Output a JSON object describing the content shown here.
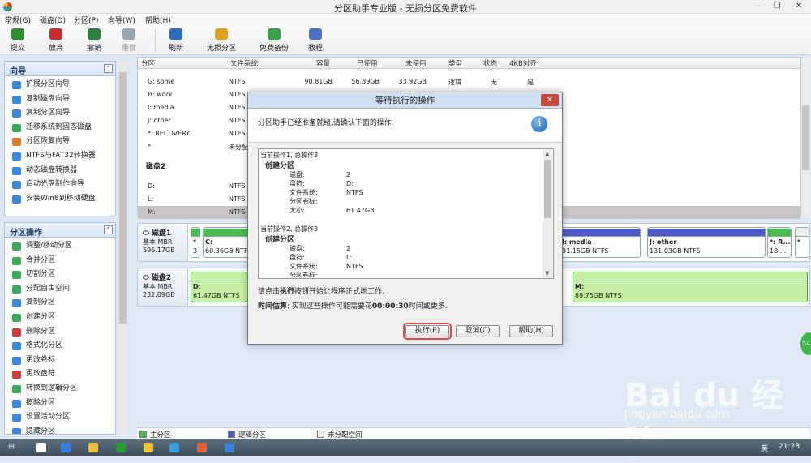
{
  "window": {
    "title": "分区助手专业版 - 无损分区免费软件",
    "min_label": "—",
    "max_label": "❐",
    "close_label": "✕"
  },
  "menu": [
    "常规(G)",
    "磁盘(D)",
    "分区(P)",
    "向导(W)",
    "帮助(H)"
  ],
  "toolbar": [
    {
      "label": "提交",
      "color": "#2f8f2f",
      "disabled": false
    },
    {
      "label": "放弃",
      "color": "#cc2b2b",
      "disabled": false
    },
    {
      "label": "撤销",
      "color": "#2f7f3f",
      "disabled": false
    },
    {
      "label": "重做",
      "color": "#9aa6b0",
      "disabled": true
    },
    {
      "label": "刷新",
      "color": "#2a6cc2",
      "disabled": false
    },
    {
      "label": "无损分区",
      "color": "#e0a020",
      "disabled": false
    },
    {
      "label": "免费备份",
      "color": "#3aa04a",
      "disabled": false
    },
    {
      "label": "教程",
      "color": "#4a72c4",
      "disabled": false
    }
  ],
  "wizard_panel": {
    "title": "向导",
    "collapse": "⌃",
    "items": [
      {
        "label": "扩展分区向导",
        "color": "#3d88d9"
      },
      {
        "label": "复制磁盘向导",
        "color": "#3d88d9"
      },
      {
        "label": "复制分区向导",
        "color": "#3d88d9"
      },
      {
        "label": "迁移系统到固态磁盘",
        "color": "#3da95a"
      },
      {
        "label": "分区恢复向导",
        "color": "#e07b28"
      },
      {
        "label": "NTFS与FAT32转换器",
        "color": "#3d88d9"
      },
      {
        "label": "动态磁盘转换器",
        "color": "#3d88d9"
      },
      {
        "label": "启动光盘制作向导",
        "color": "#3d88d9"
      },
      {
        "label": "安装Win8到移动硬盘",
        "color": "#3d88d9"
      }
    ]
  },
  "ops_panel": {
    "title": "分区操作",
    "collapse": "⌃",
    "items": [
      {
        "label": "调整/移动分区",
        "color": "#3da95a"
      },
      {
        "label": "合并分区",
        "color": "#3da95a"
      },
      {
        "label": "切割分区",
        "color": "#3da95a"
      },
      {
        "label": "分配自由空间",
        "color": "#3da95a"
      },
      {
        "label": "复制分区",
        "color": "#3d88d9"
      },
      {
        "label": "创建分区",
        "color": "#3da95a"
      },
      {
        "label": "删除分区",
        "color": "#d33b3b"
      },
      {
        "label": "格式化分区",
        "color": "#3d88d9"
      },
      {
        "label": "更改卷标",
        "color": "#3d88d9"
      },
      {
        "label": "更改盘符",
        "color": "#d33b3b"
      },
      {
        "label": "转换到逻辑分区",
        "color": "#3da95a"
      },
      {
        "label": "擦除分区",
        "color": "#3d88d9"
      },
      {
        "label": "设置活动分区",
        "color": "#3d88d9"
      },
      {
        "label": "隐藏分区",
        "color": "#3d88d9"
      }
    ]
  },
  "table": {
    "headers": [
      "分区",
      "文件系统",
      "容量",
      "已使用",
      "未使用",
      "类型",
      "状态",
      "4KB对齐"
    ],
    "rows": [
      {
        "name": "G: some",
        "fs": "NTFS",
        "cap": "90.81GB",
        "used": "56.89GB",
        "free": "33.92GB",
        "type": "逻辑",
        "status": "无",
        "align": "是"
      },
      {
        "name": "H: work",
        "fs": "NTFS",
        "cap": "",
        "used": "",
        "free": "",
        "type": "",
        "status": "",
        "align": ""
      },
      {
        "name": "I: media",
        "fs": "NTFS",
        "cap": "",
        "used": "",
        "free": "",
        "type": "",
        "status": "",
        "align": ""
      },
      {
        "name": "J: other",
        "fs": "NTFS",
        "cap": "",
        "used": "",
        "free": "",
        "type": "",
        "status": "",
        "align": ""
      },
      {
        "name": "*: RECOVERY",
        "fs": "NTFS",
        "cap": "",
        "used": "",
        "free": "",
        "type": "",
        "status": "",
        "align": ""
      },
      {
        "name": "*",
        "fs": "未分配",
        "cap": "",
        "used": "",
        "free": "",
        "type": "",
        "status": "",
        "align": ""
      }
    ],
    "disk2_label": "磁盘2",
    "disk2_rows": [
      {
        "name": "D:",
        "fs": "NTFS"
      },
      {
        "name": "L:",
        "fs": "NTFS"
      },
      {
        "name": "M:",
        "fs": "NTFS"
      }
    ]
  },
  "disk1": {
    "name": "磁盘1",
    "kind": "基本 MBR",
    "size": "596.17GB",
    "parts": [
      {
        "name": "*",
        "size": "3",
        "bar": "#4dbb4d"
      },
      {
        "name": "C:",
        "size": "60.36GB NTFS",
        "bar": "#4dbb4d"
      },
      {
        "name": "I: media",
        "size": "91.15GB NTFS",
        "bar": "#5058c8"
      },
      {
        "name": "J: other",
        "size": "131.03GB NTFS",
        "bar": "#5058c8"
      },
      {
        "name": "*: R...",
        "size": "18....",
        "bar": "#4dbb4d"
      },
      {
        "name": "*",
        "size": "",
        "bar": "#eeeeee"
      }
    ]
  },
  "disk2": {
    "name": "磁盘2",
    "kind": "基本 MBR",
    "size": "232.89GB",
    "parts": [
      {
        "name": "D:",
        "size": "61.47GB NTFS",
        "bar": "#c8f0a4"
      },
      {
        "name": "M:",
        "size": "89.75GB NTFS",
        "bar": "#c8f0a4"
      }
    ]
  },
  "legend": [
    {
      "label": "主分区",
      "color": "#4dbb4d"
    },
    {
      "label": "逻辑分区",
      "color": "#5058c8"
    },
    {
      "label": "未分配空间",
      "color": "#f4efe6"
    }
  ],
  "dialog": {
    "title": "等待执行的操作",
    "close": "✕",
    "banner": "分区助手已经准备就绪,请确认下面的操作.",
    "info_icon": "i",
    "ops": [
      {
        "head": "当前操作1, 总操作3",
        "sub": "创建分区",
        "rows": [
          [
            "磁盘:",
            "2"
          ],
          [
            "盘符:",
            "D:"
          ],
          [
            "文件系统:",
            "NTFS"
          ],
          [
            "分区卷标:",
            ""
          ],
          [
            "大小:",
            "61.47GB"
          ]
        ]
      },
      {
        "head": "当前操作2, 总操作3",
        "sub": "创建分区",
        "rows": [
          [
            "磁盘:",
            "2"
          ],
          [
            "盘符:",
            "L:"
          ],
          [
            "文件系统:",
            "NTFS"
          ],
          [
            "分区卷标:",
            ""
          ]
        ]
      }
    ],
    "hint_pre": "请点击",
    "hint_bold": "执行",
    "hint_post": "按钮开始让程序正式地工作.",
    "est_label": "时间估算",
    "est_pre": ": 实现这些操作可能需要花",
    "est_time": "00:00:30",
    "est_post": "时间或更多.",
    "buttons": {
      "execute": "执行(P)",
      "cancel": "取消(C)",
      "help": "帮助(H)"
    }
  },
  "taskbar": {
    "tray_lang": "英",
    "time": "21:28",
    "apps": [
      "#ffffff",
      "#3a7fd9",
      "#f0c040",
      "#2a9a3a",
      "#f3c53a",
      "#34a0e0",
      "#e0603a",
      "#3a7fd9"
    ]
  },
  "watermark": {
    "main": "Bai du 经验",
    "sub": "jingyan.baidu.com"
  },
  "side_badge": "54"
}
